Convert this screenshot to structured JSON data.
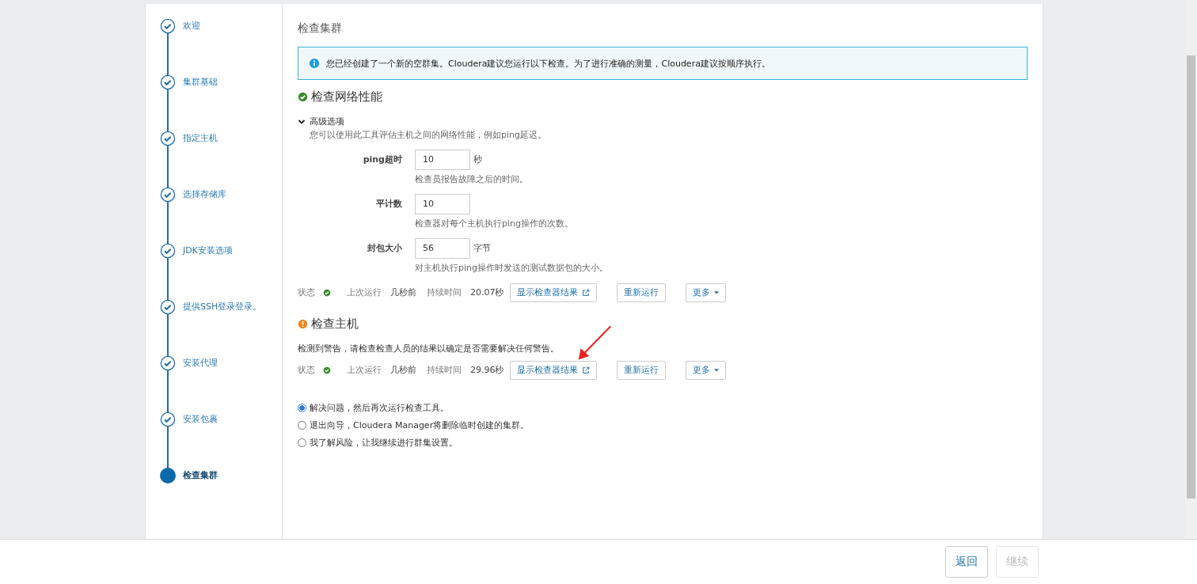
{
  "steps": [
    {
      "label": "欢迎",
      "selected": false
    },
    {
      "label": "集群基础",
      "selected": false
    },
    {
      "label": "指定主机",
      "selected": false
    },
    {
      "label": "选择存储库",
      "selected": false
    },
    {
      "label": "JDK安装选项",
      "selected": false
    },
    {
      "label": "提供SSH登录登录。",
      "selected": false
    },
    {
      "label": "安装代理",
      "selected": false
    },
    {
      "label": "安装包裹",
      "selected": false
    },
    {
      "label": "检查集群",
      "selected": true
    }
  ],
  "page_title": "检查集群",
  "info_message": "您已经创建了一个新的空群集。Cloudera建议您运行以下检查。为了进行准确的测量，Cloudera建议按顺序执行。",
  "checks": [
    {
      "title": "检查网络性能",
      "warning": false,
      "advanced": {
        "label": "高级选项",
        "expanded": true,
        "description": "您可以使用此工具评估主机之间的网络性能，例如ping延迟。",
        "fields": [
          {
            "label": "ping超时",
            "value": "10",
            "unit": "秒",
            "help": "检查员报告故障之后的时间。"
          },
          {
            "label": "平计数",
            "value": "10",
            "help": "检查器对每个主机执行ping操作的次数。"
          },
          {
            "label": "封包大小",
            "value": "56",
            "unit": "字节",
            "help": "对主机执行ping操作时发送的测试数据包的大小。"
          }
        ]
      },
      "status_label": "状态",
      "passed": true,
      "last_run_label": "上次运行",
      "last_run": "几秒前",
      "duration_label": "持续时间",
      "duration": "20.07秒",
      "buttons": {
        "show_results": "显示检查器结果",
        "rerun": "重新运行",
        "more": "更多"
      }
    },
    {
      "title": "检查主机",
      "warning": true,
      "description": "检测到警告，请检查检查人员的结果以确定是否需要解决任何警告。",
      "status_label": "状态",
      "passed": true,
      "last_run_label": "上次运行",
      "last_run": "几秒前",
      "duration_label": "持续时间",
      "duration": "29.96秒",
      "buttons": {
        "show_results": "显示检查器结果",
        "rerun": "重新运行",
        "more": "更多"
      }
    }
  ],
  "options": [
    {
      "label": "解决问题，然后再次运行检查工具。",
      "selected": true
    },
    {
      "label": "退出向导，Cloudera Manager将删除临时创建的集群。",
      "selected": false
    },
    {
      "label": "我了解风险，让我继续进行群集设置。",
      "selected": false
    }
  ],
  "footer": {
    "back": {
      "label": "返回",
      "disabled": false
    },
    "continue": {
      "label": "继续",
      "disabled": true
    }
  }
}
